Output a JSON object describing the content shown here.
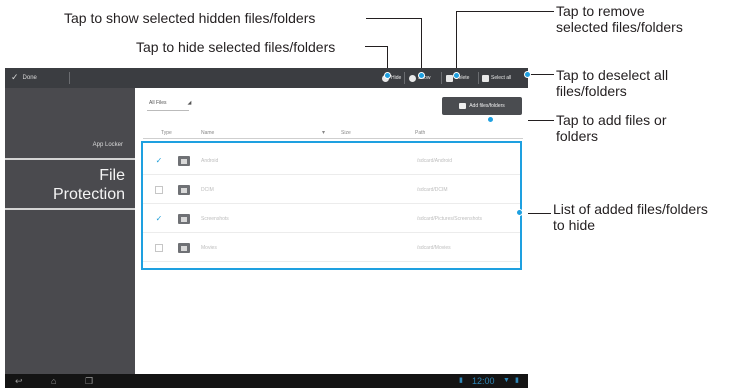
{
  "callouts": {
    "show_hidden": "Tap to show selected hidden files/folders",
    "hide": "Tap to hide selected files/folders",
    "remove_line1": "Tap to remove",
    "remove_line2": "selected files/folders",
    "deselect_line1": "Tap to deselect all",
    "deselect_line2": "files/folders",
    "add_line1": "Tap to add files or",
    "add_line2": "folders",
    "list_line1": "List of added files/folders",
    "list_line2": "to hide"
  },
  "action_bar": {
    "done_label": "Done",
    "hide_label": "Hide",
    "show_label": "Show",
    "delete_label": "Delete",
    "select_all_label": "Select all"
  },
  "sidebar": {
    "app_name": "App Locker",
    "section_title_line1": "File",
    "section_title_line2": "Protection"
  },
  "content": {
    "filter_label": "All Files",
    "add_button_label": "Add files/folders",
    "columns": [
      "Type",
      "Name",
      "Size",
      "Path"
    ]
  },
  "rows": [
    {
      "checked": true,
      "name": "Android",
      "path": "/sdcard/Android"
    },
    {
      "checked": false,
      "name": "DCIM",
      "path": "/sdcard/DCIM"
    },
    {
      "checked": true,
      "name": "Screenshots",
      "path": "/sdcard/Pictures/Screenshots"
    },
    {
      "checked": false,
      "name": "Movies",
      "path": "/sdcard/Movies"
    }
  ],
  "status_bar": {
    "clock": "12:00"
  },
  "colors": {
    "highlight": "#1ea0e0",
    "action_bar": "#3b3d41",
    "sidebar": "#4a4a4e",
    "nav_bar": "#141414"
  }
}
